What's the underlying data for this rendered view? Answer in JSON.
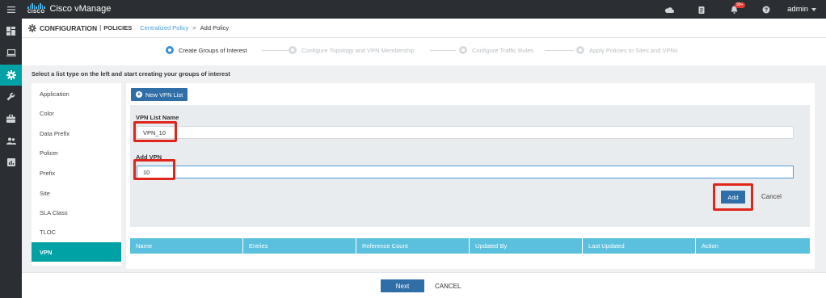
{
  "app": {
    "logo_text": "CISCO",
    "title": "Cisco vManage",
    "notifications_count": "99+",
    "user": "admin"
  },
  "header": {
    "section": "CONFIGURATION",
    "separator": "|",
    "subsection": "POLICIES",
    "breadcrumb_link": "Centralized Policy",
    "breadcrumb_sep": ">",
    "breadcrumb_current": "Add Policy"
  },
  "stepper": {
    "steps": [
      {
        "label": "Create Groups of Interest",
        "state": "active"
      },
      {
        "label": "Configure Topology and VPN Membership",
        "state": "idle"
      },
      {
        "label": "Configure Traffic Rules",
        "state": "idle"
      },
      {
        "label": "Apply Policies to Sites and VPNs",
        "state": "idle"
      }
    ]
  },
  "instructions": "Select a list type on the left and start creating your groups of interest",
  "list_types": [
    {
      "label": "Application"
    },
    {
      "label": "Color"
    },
    {
      "label": "Data Prefix"
    },
    {
      "label": "Policer"
    },
    {
      "label": "Prefix"
    },
    {
      "label": "Site"
    },
    {
      "label": "SLA Class"
    },
    {
      "label": "TLOC"
    },
    {
      "label": "VPN",
      "active": true
    }
  ],
  "panel": {
    "new_button": "New VPN List",
    "vpn_list_name_label": "VPN List Name",
    "vpn_list_name_value": "VPN_10",
    "add_vpn_label": "Add VPN",
    "add_vpn_value": "10",
    "add_button": "Add",
    "cancel_button": "Cancel"
  },
  "table": {
    "columns": [
      "Name",
      "Entries",
      "Reference Count",
      "Updated By",
      "Last Updated",
      "Action"
    ],
    "rows": []
  },
  "footer": {
    "next_button": "Next",
    "cancel_button": "CANCEL"
  },
  "colors": {
    "topbar": "#2b2f33",
    "accent_teal": "#00a2a6",
    "primary_button": "#2f6ea6",
    "table_header": "#5bc0de",
    "highlight": "#e0251b"
  }
}
